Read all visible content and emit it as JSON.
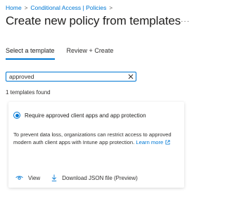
{
  "breadcrumb": {
    "items": [
      "Home",
      "Conditional Access | Policies"
    ],
    "separator": ">"
  },
  "header": {
    "title": "Create new policy from templates",
    "more": "···"
  },
  "tabs": [
    {
      "label": "Select a template",
      "active": true
    },
    {
      "label": "Review + Create",
      "active": false
    }
  ],
  "search": {
    "value": "approved",
    "clear_icon": "close-icon"
  },
  "results": {
    "count_text": "1 templates found"
  },
  "template_card": {
    "title": "Require approved client apps and app protection",
    "selected": true,
    "description": "To prevent data loss, organizations can restrict access to approved modern auth client apps with Intune app protection.",
    "learn_more": "Learn more",
    "actions": {
      "view": "View",
      "download": "Download JSON file (Preview)"
    }
  },
  "colors": {
    "accent": "#0078d4",
    "text": "#323130"
  }
}
